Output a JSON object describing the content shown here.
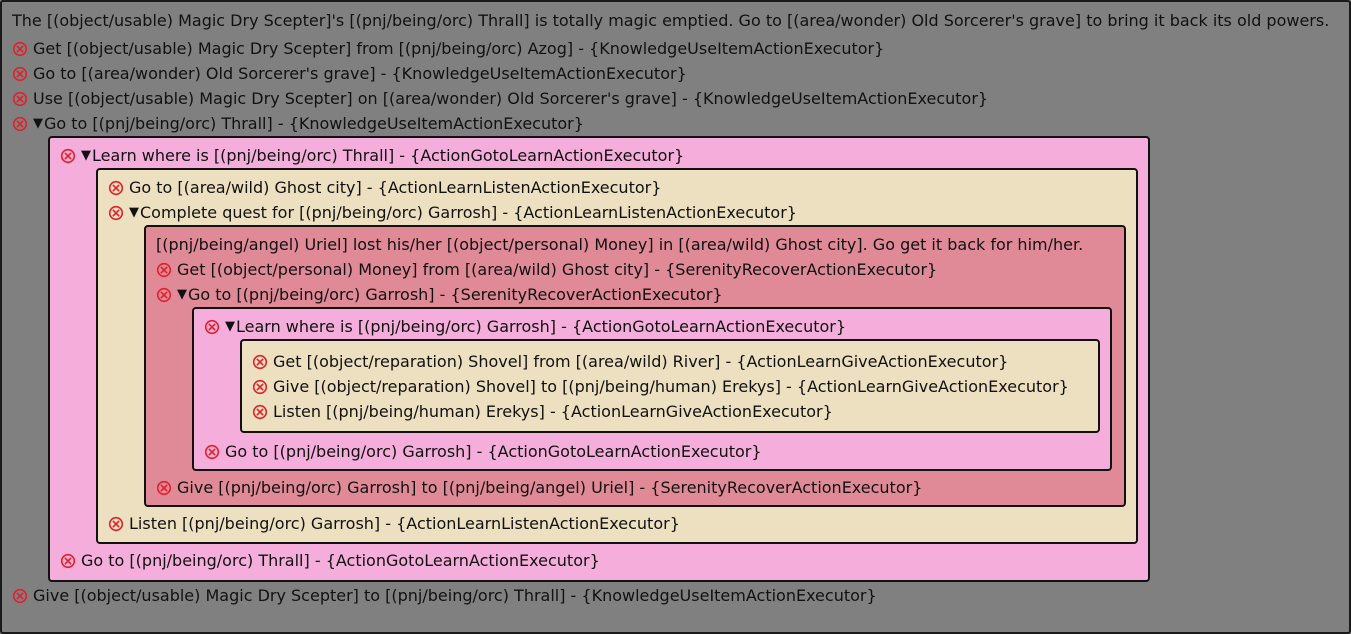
{
  "quest": {
    "description": "The [(object/usable) Magic Dry Scepter]'s [(pnj/being/orc) Thrall] is totally magic emptied. Go to [(area/wonder) Old Sorcerer's grave] to bring it back its old powers.",
    "steps": [
      "Get [(object/usable) Magic Dry Scepter] from [(pnj/being/orc) Azog] - {KnowledgeUseItemActionExecutor}",
      "Go to [(area/wonder) Old Sorcerer's grave] - {KnowledgeUseItemActionExecutor}",
      "Use [(object/usable) Magic Dry Scepter] on [(area/wonder) Old Sorcerer's grave] - {KnowledgeUseItemActionExecutor}",
      "Go to [(pnj/being/orc) Thrall] - {KnowledgeUseItemActionExecutor}"
    ],
    "learn_thrall": {
      "header": "Learn where is [(pnj/being/orc) Thrall] - {ActionGotoLearnActionExecutor}",
      "listen": {
        "step_go_ghost": "Go to [(area/wild) Ghost city] - {ActionLearnListenActionExecutor}",
        "step_complete": "Complete quest for [(pnj/being/orc) Garrosh] - {ActionLearnListenActionExecutor}",
        "serenity": {
          "description": "[(pnj/being/angel) Uriel] lost his/her [(object/personal) Money] in [(area/wild) Ghost city]. Go get it back for him/her.",
          "step_get_money": "Get [(object/personal) Money] from [(area/wild) Ghost city] - {SerenityRecoverActionExecutor}",
          "step_go_garrosh": "Go to [(pnj/being/orc) Garrosh] - {SerenityRecoverActionExecutor}",
          "learn_garrosh": {
            "header": "Learn where is [(pnj/being/orc) Garrosh] - {ActionGotoLearnActionExecutor}",
            "give": [
              "Get [(object/reparation) Shovel] from [(area/wild) River] - {ActionLearnGiveActionExecutor}",
              "Give [(object/reparation) Shovel] to [(pnj/being/human) Erekys] - {ActionLearnGiveActionExecutor}",
              "Listen [(pnj/being/human) Erekys] - {ActionLearnGiveActionExecutor}"
            ],
            "step_go_garrosh": "Go to [(pnj/being/orc) Garrosh] - {ActionGotoLearnActionExecutor}"
          },
          "step_give_garrosh": "Give [(pnj/being/orc) Garrosh] to [(pnj/being/angel) Uriel] - {SerenityRecoverActionExecutor}"
        },
        "step_listen_garrosh": "Listen [(pnj/being/orc) Garrosh] - {ActionLearnListenActionExecutor}"
      },
      "step_go_thrall": "Go to [(pnj/being/orc) Thrall] - {ActionGotoLearnActionExecutor}"
    },
    "final_step": "Give [(object/usable) Magic Dry Scepter] to [(pnj/being/orc) Thrall] - {KnowledgeUseItemActionExecutor}"
  },
  "icons": {
    "status": "failed-circle-x-icon",
    "expand": "expand-triangle-icon",
    "status_color": "#e0202a",
    "expand_glyph": "▼"
  },
  "colors": {
    "background": "#808080",
    "pink": "#f5aedb",
    "tan": "#ede0c0",
    "red": "#e08a98"
  }
}
